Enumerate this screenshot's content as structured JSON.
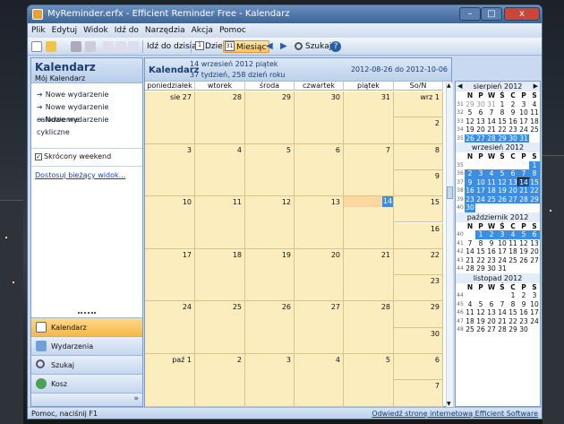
{
  "window": {
    "title": "MyReminder.erfx - Efficient Reminder Free - Kalendarz",
    "minimize": "–",
    "maximize": "□",
    "close": "x"
  },
  "menu": [
    "Plik",
    "Edytuj",
    "Widok",
    "Idź do",
    "Narzędzia",
    "Akcja",
    "Pomoc"
  ],
  "toolbar": {
    "goto_today": "Idź do dzisiaj",
    "day": "Dzień",
    "month": "Miesiąc",
    "search": "Szukaj",
    "day_num": "1",
    "month_num": "31"
  },
  "sidebar": {
    "title": "Kalendarz",
    "subtitle": "Mój Kalendarz",
    "actions": [
      "Nowe wydarzenie",
      "Nowe wydarzenie całodzienne",
      "Nowe wydarzenie cykliczne"
    ],
    "short_weekend": "Skrócony weekend",
    "customize": "Dostosuj bieżący widok...",
    "nav": [
      "Kalendarz",
      "Wydarzenia",
      "Szukaj",
      "Kosz"
    ]
  },
  "calendar": {
    "title": "Kalendarz",
    "date_line": "14 wrzesień 2012 piątek",
    "week_line": "37 tydzień,  258 dzień roku",
    "range": "2012-08-26 do 2012-10-06",
    "day_headers": [
      "poniedziałek",
      "wtorek",
      "środa",
      "czwartek",
      "piątek",
      "So/N"
    ],
    "weeks": [
      [
        "sie 27",
        "28",
        "29",
        "30",
        "31",
        "wrz 1",
        "2"
      ],
      [
        "3",
        "4",
        "5",
        "6",
        "7",
        "8",
        "9"
      ],
      [
        "10",
        "11",
        "12",
        "13",
        "14",
        "15",
        "16"
      ],
      [
        "17",
        "18",
        "19",
        "20",
        "21",
        "22",
        "23"
      ],
      [
        "24",
        "25",
        "26",
        "27",
        "28",
        "29",
        "30"
      ],
      [
        "paź 1",
        "2",
        "3",
        "4",
        "5",
        "6",
        "7"
      ]
    ],
    "today": "14"
  },
  "mini": {
    "dow": [
      "N",
      "P",
      "W",
      "Ś",
      "C",
      "P",
      "S"
    ],
    "months": [
      {
        "title": "sierpień 2012",
        "weeks": [
          [
            "31",
            "29",
            "30",
            "31",
            "1",
            "2",
            "3",
            "4"
          ],
          [
            "32",
            "5",
            "6",
            "7",
            "8",
            "9",
            "10",
            "11"
          ],
          [
            "33",
            "12",
            "13",
            "14",
            "15",
            "16",
            "17",
            "18"
          ],
          [
            "34",
            "19",
            "20",
            "21",
            "22",
            "23",
            "24",
            "25"
          ],
          [
            "35",
            "26",
            "27",
            "28",
            "29",
            "30",
            "31",
            ""
          ]
        ]
      },
      {
        "title": "wrzesień 2012",
        "weeks": [
          [
            "35",
            "",
            "",
            "",
            "",
            "",
            "",
            "1"
          ],
          [
            "36",
            "2",
            "3",
            "4",
            "5",
            "6",
            "7",
            "8"
          ],
          [
            "37",
            "9",
            "10",
            "11",
            "12",
            "13",
            "14",
            "15"
          ],
          [
            "38",
            "16",
            "17",
            "18",
            "19",
            "20",
            "21",
            "22"
          ],
          [
            "39",
            "23",
            "24",
            "25",
            "26",
            "27",
            "28",
            "29"
          ],
          [
            "40",
            "30",
            "",
            "",
            "",
            "",
            "",
            ""
          ]
        ]
      },
      {
        "title": "październik 2012",
        "weeks": [
          [
            "40",
            "",
            "1",
            "2",
            "3",
            "4",
            "5",
            "6"
          ],
          [
            "41",
            "7",
            "8",
            "9",
            "10",
            "11",
            "12",
            "13"
          ],
          [
            "42",
            "14",
            "15",
            "16",
            "17",
            "18",
            "19",
            "20"
          ],
          [
            "43",
            "21",
            "22",
            "23",
            "24",
            "25",
            "26",
            "27"
          ],
          [
            "44",
            "28",
            "29",
            "30",
            "31",
            "",
            "",
            ""
          ]
        ]
      },
      {
        "title": "listopad 2012",
        "weeks": [
          [
            "44",
            "",
            "",
            "",
            "",
            "1",
            "2",
            "3"
          ],
          [
            "45",
            "4",
            "5",
            "6",
            "7",
            "8",
            "9",
            "10"
          ],
          [
            "46",
            "11",
            "12",
            "13",
            "14",
            "15",
            "16",
            "17"
          ],
          [
            "47",
            "18",
            "19",
            "20",
            "21",
            "22",
            "23",
            "24"
          ],
          [
            "48",
            "25",
            "26",
            "27",
            "28",
            "29",
            "30",
            ""
          ]
        ]
      }
    ]
  },
  "status": {
    "left": "Pomoc, naciśnij F1",
    "right": "Odwiedź stronę internetową Efficient Software"
  },
  "colors": {
    "cell": "#fbedbe",
    "accent": "#3c8ee4",
    "frame": "#c9daf0"
  }
}
